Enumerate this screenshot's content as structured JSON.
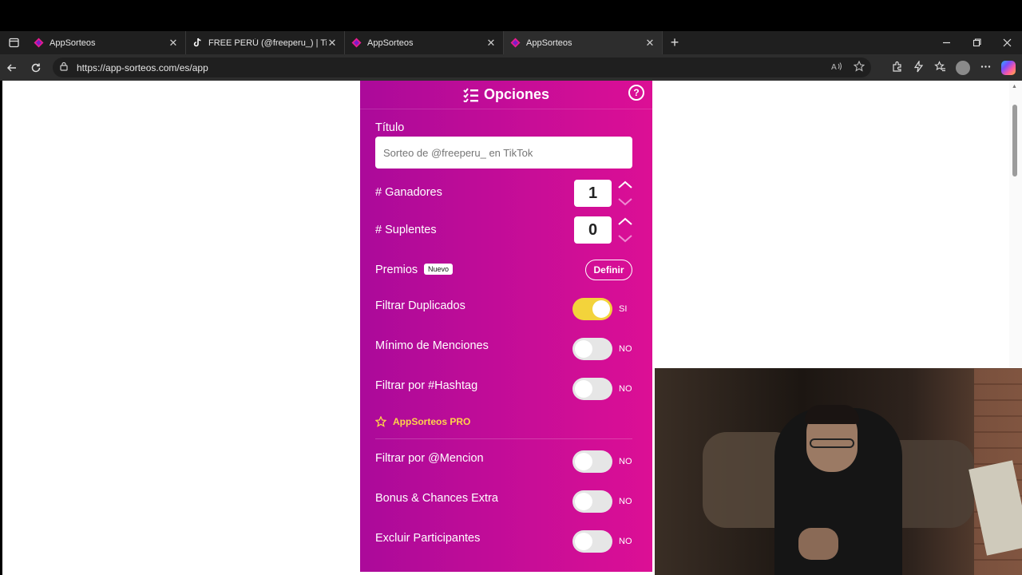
{
  "browser": {
    "tabs": [
      {
        "label": "AppSorteos",
        "icon": "appsorteos-logo-icon",
        "active": false
      },
      {
        "label": "FREE PERÚ (@freeperu_) | TikTok",
        "icon": "tiktok-icon",
        "active": false
      },
      {
        "label": "AppSorteos",
        "icon": "appsorteos-logo-icon",
        "active": false
      },
      {
        "label": "AppSorteos",
        "icon": "appsorteos-logo-icon",
        "active": true
      }
    ],
    "close_glyph": "✕",
    "new_tab_glyph": "+",
    "url": "https://app-sorteos.com/es/app"
  },
  "panel": {
    "title": "Opciones",
    "help_glyph": "?",
    "titulo_label": "Título",
    "titulo_placeholder": "Sorteo de @freeperu_ en TikTok",
    "ganadores_label": "# Ganadores",
    "ganadores_value": "1",
    "suplentes_label": "# Suplentes",
    "suplentes_value": "0",
    "premios_label": "Premios",
    "premios_badge": "Nuevo",
    "definir_label": "Definir",
    "toggles": [
      {
        "label": "Filtrar Duplicados",
        "state": "SI",
        "on": true
      },
      {
        "label": "Mínimo de Menciones",
        "state": "NO",
        "on": false
      },
      {
        "label": "Filtrar por #Hashtag",
        "state": "NO",
        "on": false
      }
    ],
    "pro_label": "AppSorteos PRO",
    "pro_toggles": [
      {
        "label": "Filtrar por @Mencion",
        "state": "NO",
        "on": false
      },
      {
        "label": "Bonus & Chances Extra",
        "state": "NO",
        "on": false
      },
      {
        "label": "Excluir Participantes",
        "state": "NO",
        "on": false
      }
    ]
  },
  "colors": {
    "panel_gradient_start": "#ab0a9a",
    "panel_gradient_end": "#dc0f95",
    "toggle_on": "#f3d33b",
    "pro_accent": "#ffd44a"
  }
}
